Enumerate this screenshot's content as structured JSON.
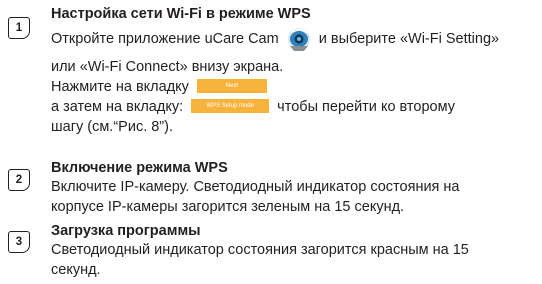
{
  "steps": [
    {
      "number": "1",
      "title": "Настройка сети Wi-Fi в режиме WPS",
      "line1_before_icon": "Откройте приложение uCare Cam",
      "line1_after_icon": "и выберите «Wi-Fi Setting»",
      "line2": "или «Wi-Fi Connect» внизу экрана.",
      "line3_text": "Нажмите на вкладку",
      "tab1_label": "Next",
      "line4_text": "а затем на вкладку:",
      "tab2_label": "WPS Setup mode",
      "line4_after": "чтобы перейти ко второму",
      "line5": "шагу (см.“Рис. 8”)."
    },
    {
      "number": "2",
      "title": "Включение режима WPS",
      "line1": "Включите IP-камеру. Светодиодный индикатор состояния на",
      "line2": "корпусе IP-камеры загорится зеленым на 15 секунд."
    },
    {
      "number": "3",
      "title": "Загрузка программы",
      "line1": "Светодиодный индикатор состояния загорится красным на 15",
      "line2": "секунд."
    }
  ],
  "colors": {
    "text": "#231f20",
    "tab_bg": "#f7b23b",
    "app_icon_body": "#2f7fb8"
  },
  "icons": {
    "app_icon": "ucare-cam-app-icon"
  }
}
